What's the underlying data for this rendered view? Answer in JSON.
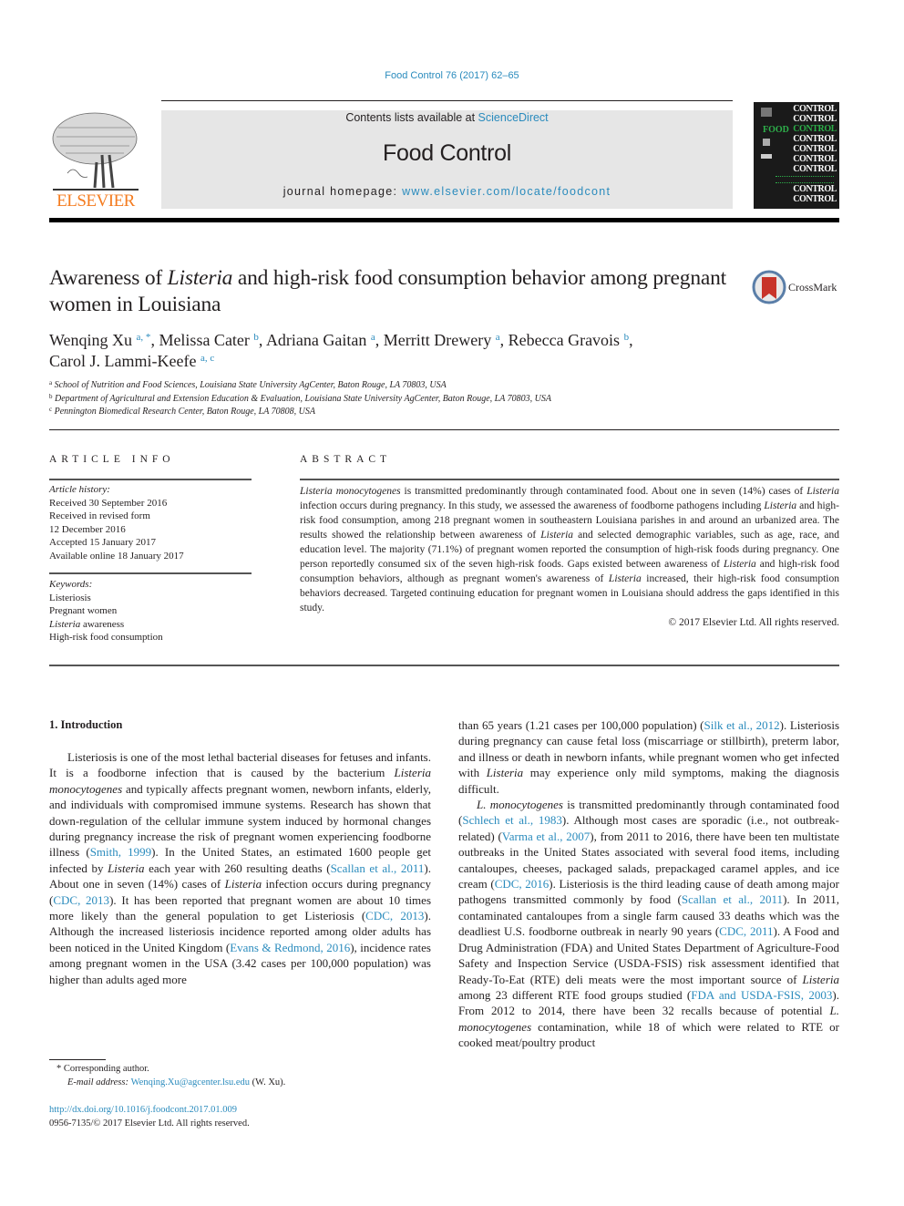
{
  "header": {
    "journal_ref": "Food Control 76 (2017) 62–65",
    "contents_prefix": "Contents lists available at ",
    "contents_link": "ScienceDirect",
    "journal_title": "Food Control",
    "homepage_prefix": "journal homepage: ",
    "homepage_link": "www.elsevier.com/locate/foodcont",
    "publisher_logo": "ELSEVIER",
    "cover_word": "CONTROL",
    "cover_food": "FOOD"
  },
  "article": {
    "title_part1": "Awareness of ",
    "title_italic": "Listeria",
    "title_part2": " and high-risk food consumption behavior among pregnant women in Louisiana",
    "crossmark_label": "CrossMark",
    "authors": [
      {
        "name": "Wenqing Xu",
        "sup": "a, *"
      },
      {
        "name": "Melissa Cater",
        "sup": "b"
      },
      {
        "name": "Adriana Gaitan",
        "sup": "a"
      },
      {
        "name": "Merritt Drewery",
        "sup": "a"
      },
      {
        "name": "Rebecca Gravois",
        "sup": "b"
      },
      {
        "name": "Carol J. Lammi-Keefe",
        "sup": "a, c"
      }
    ],
    "affiliations": [
      {
        "key": "a",
        "text": "School of Nutrition and Food Sciences, Louisiana State University AgCenter, Baton Rouge, LA 70803, USA"
      },
      {
        "key": "b",
        "text": "Department of Agricultural and Extension Education & Evaluation, Louisiana State University AgCenter, Baton Rouge, LA 70803, USA"
      },
      {
        "key": "c",
        "text": "Pennington Biomedical Research Center, Baton Rouge, LA 70808, USA"
      }
    ]
  },
  "article_info": {
    "heading": "ARTICLE INFO",
    "history_label": "Article history:",
    "history": [
      "Received 30 September 2016",
      "Received in revised form",
      "12 December 2016",
      "Accepted 15 January 2017",
      "Available online 18 January 2017"
    ],
    "keywords_label": "Keywords:",
    "keywords": [
      "Listeriosis",
      "Pregnant women",
      "Listeria awareness",
      "High-risk food consumption"
    ]
  },
  "abstract": {
    "heading": "ABSTRACT",
    "s1_italic": "Listeria monocytogenes",
    "s1": " is transmitted predominantly through contaminated food. About one in seven (14%) cases of ",
    "s2_italic": "Listeria",
    "s2": " infection occurs during pregnancy. In this study, we assessed the awareness of foodborne pathogens including ",
    "s3_italic": "Listeria",
    "s3": " and high-risk food consumption, among 218 pregnant women in southeastern Louisiana parishes in and around an urbanized area. The results showed the relationship between awareness of ",
    "s4_italic": "Listeria",
    "s4": " and selected demographic variables, such as age, race, and education level. The majority (71.1%) of pregnant women reported the consumption of high-risk foods during pregnancy. One person reportedly consumed six of the seven high-risk foods. Gaps existed between awareness of ",
    "s5_italic": "Listeria",
    "s5": " and high-risk food consumption behaviors, although as pregnant women's awareness of ",
    "s6_italic": "Listeria",
    "s6": " increased, their high-risk food consumption behaviors decreased. Targeted continuing education for pregnant women in Louisiana should address the gaps identified in this study.",
    "copyright": "© 2017 Elsevier Ltd. All rights reserved."
  },
  "intro": {
    "heading": "1.  Introduction",
    "left": [
      {
        "t": "Listeriosis is one of the most lethal bacterial diseases for fetuses and infants. It is a foodborne infection that is caused by the bacterium "
      },
      {
        "i": "Listeria monocytogenes"
      },
      {
        "t": " and typically affects pregnant women, newborn infants, elderly, and individuals with compromised immune systems. Research has shown that down-regulation of the cellular immune system induced by hormonal changes during pregnancy increase the risk of pregnant women experiencing foodborne illness ("
      },
      {
        "l": "Smith, 1999"
      },
      {
        "t": "). In the United States, an estimated 1600 people get infected by "
      },
      {
        "i": "Listeria"
      },
      {
        "t": " each year with 260 resulting deaths ("
      },
      {
        "l": "Scallan et al., 2011"
      },
      {
        "t": "). About one in seven (14%) cases of "
      },
      {
        "i": "Listeria"
      },
      {
        "t": " infection occurs during pregnancy ("
      },
      {
        "l": "CDC, 2013"
      },
      {
        "t": "). It has been reported that pregnant women are about 10 times more likely than the general population to get Listeriosis ("
      },
      {
        "l": "CDC, 2013"
      },
      {
        "t": "). Although the increased listeriosis incidence reported among older adults has been noticed in the United Kingdom ("
      },
      {
        "l": "Evans & Redmond, 2016"
      },
      {
        "t": "), incidence rates among pregnant women in the USA (3.42 cases per 100,000 population) was higher than adults aged more"
      }
    ],
    "right_p1": [
      {
        "t": "than 65 years (1.21 cases per 100,000 population) ("
      },
      {
        "l": "Silk et al., 2012"
      },
      {
        "t": "). Listeriosis during pregnancy can cause fetal loss (miscarriage or stillbirth), preterm labor, and illness or death in newborn infants, while pregnant women who get infected with "
      },
      {
        "i": "Listeria"
      },
      {
        "t": " may experience only mild symptoms, making the diagnosis difficult."
      }
    ],
    "right_p2": [
      {
        "i": "L. monocytogenes"
      },
      {
        "t": " is transmitted predominantly through contaminated food ("
      },
      {
        "l": "Schlech et al., 1983"
      },
      {
        "t": "). Although most cases are sporadic (i.e., not outbreak-related) ("
      },
      {
        "l": "Varma et al., 2007"
      },
      {
        "t": "), from 2011 to 2016, there have been ten multistate outbreaks in the United States associated with several food items, including cantaloupes, cheeses, packaged salads, prepackaged caramel apples, and ice cream ("
      },
      {
        "l": "CDC, 2016"
      },
      {
        "t": "). Listeriosis is the third leading cause of death among major pathogens transmitted commonly by food ("
      },
      {
        "l": "Scallan et al., 2011"
      },
      {
        "t": "). In 2011, contaminated cantaloupes from a single farm caused 33 deaths which was the deadliest U.S. foodborne outbreak in nearly 90 years ("
      },
      {
        "l": "CDC, 2011"
      },
      {
        "t": "). A Food and Drug Administration (FDA) and United States Department of Agriculture-Food Safety and Inspection Service (USDA-FSIS) risk assessment identified that Ready-To-Eat (RTE) deli meats were the most important source of "
      },
      {
        "i": "Listeria"
      },
      {
        "t": " among 23 different RTE food groups studied ("
      },
      {
        "l": "FDA and USDA-FSIS, 2003"
      },
      {
        "t": "). From 2012 to 2014, there have been 32 recalls because of potential "
      },
      {
        "i": "L. monocytogenes"
      },
      {
        "t": " contamination, while 18 of which were related to RTE or cooked meat/poultry product"
      }
    ]
  },
  "footnotes": {
    "corresponding": "* Corresponding author.",
    "email_label": "E-mail address: ",
    "email": "Wenqing.Xu@agcenter.lsu.edu",
    "email_suffix": " (W. Xu).",
    "doi": "http://dx.doi.org/10.1016/j.foodcont.2017.01.009",
    "issn": "0956-7135/© 2017 Elsevier Ltd. All rights reserved."
  },
  "colors": {
    "link": "#2a8bbd",
    "elsevier_orange": "#f47c20",
    "banner_bg": "#e6e6e6",
    "cover_green": "#2eb14b"
  }
}
